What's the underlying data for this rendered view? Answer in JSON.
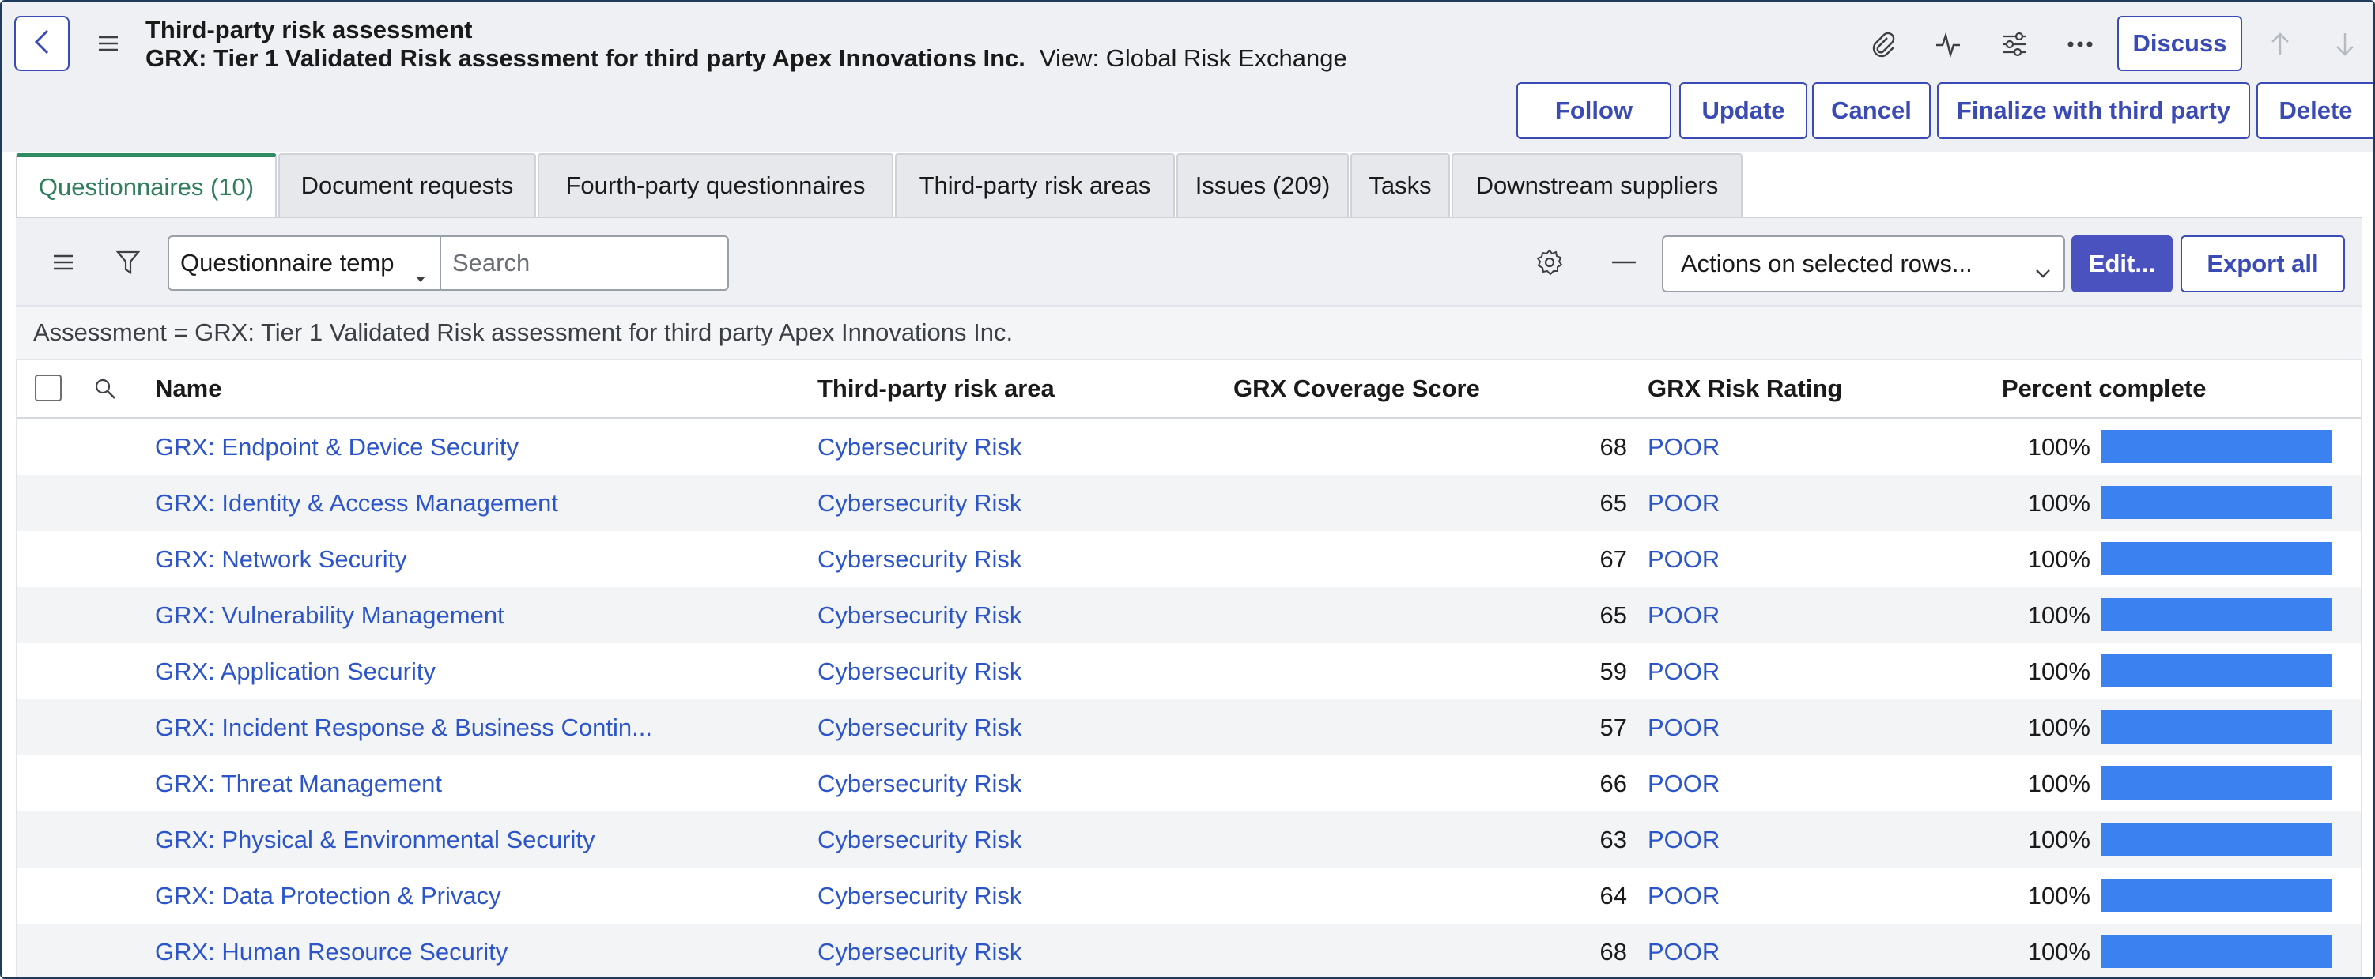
{
  "header": {
    "title": "Third-party risk assessment",
    "record_name": "GRX: Tier 1 Validated Risk assessment for third party Apex Innovations Inc.",
    "view_label": "View: Global Risk Exchange",
    "buttons": {
      "discuss": "Discuss",
      "follow": "Follow",
      "update": "Update",
      "cancel": "Cancel",
      "finalize": "Finalize with third party",
      "delete": "Delete"
    },
    "icons": [
      "back-icon",
      "hamburger-menu-icon",
      "paperclip-icon",
      "activity-icon",
      "settings-sliders-icon",
      "more-icon",
      "arrow-up-icon",
      "arrow-down-icon"
    ]
  },
  "tabs": [
    {
      "label": "Questionnaires (10)",
      "active": true
    },
    {
      "label": "Document requests",
      "active": false
    },
    {
      "label": "Fourth-party questionnaires",
      "active": false
    },
    {
      "label": "Third-party risk areas",
      "active": false
    },
    {
      "label": "Issues (209)",
      "active": false
    },
    {
      "label": "Tasks",
      "active": false
    },
    {
      "label": "Downstream suppliers",
      "active": false
    }
  ],
  "list": {
    "field_select": "Questionnaire temp",
    "search_placeholder": "Search",
    "actions_select": "Actions on selected rows...",
    "edit_label": "Edit...",
    "export_label": "Export all",
    "filter_text": "Assessment = GRX: Tier 1 Validated Risk assessment for third party Apex Innovations Inc.",
    "columns": {
      "name": "Name",
      "risk_area": "Third-party risk area",
      "coverage": "GRX Coverage Score",
      "rating": "GRX Risk Rating",
      "percent": "Percent complete"
    },
    "rows": [
      {
        "name": "GRX: Endpoint & Device Security",
        "risk_area": "Cybersecurity Risk",
        "coverage": "68",
        "rating": "POOR",
        "percent": "100%",
        "progress": 100
      },
      {
        "name": "GRX: Identity & Access Management",
        "risk_area": "Cybersecurity Risk",
        "coverage": "65",
        "rating": "POOR",
        "percent": "100%",
        "progress": 100
      },
      {
        "name": "GRX: Network Security",
        "risk_area": "Cybersecurity Risk",
        "coverage": "67",
        "rating": "POOR",
        "percent": "100%",
        "progress": 100
      },
      {
        "name": "GRX: Vulnerability Management",
        "risk_area": "Cybersecurity Risk",
        "coverage": "65",
        "rating": "POOR",
        "percent": "100%",
        "progress": 100
      },
      {
        "name": "GRX: Application Security",
        "risk_area": "Cybersecurity Risk",
        "coverage": "59",
        "rating": "POOR",
        "percent": "100%",
        "progress": 100
      },
      {
        "name": "GRX: Incident Response & Business Contin...",
        "risk_area": "Cybersecurity Risk",
        "coverage": "57",
        "rating": "POOR",
        "percent": "100%",
        "progress": 100
      },
      {
        "name": "GRX: Threat Management",
        "risk_area": "Cybersecurity Risk",
        "coverage": "66",
        "rating": "POOR",
        "percent": "100%",
        "progress": 100
      },
      {
        "name": "GRX: Physical & Environmental Security",
        "risk_area": "Cybersecurity Risk",
        "coverage": "63",
        "rating": "POOR",
        "percent": "100%",
        "progress": 100
      },
      {
        "name": "GRX: Data Protection & Privacy",
        "risk_area": "Cybersecurity Risk",
        "coverage": "64",
        "rating": "POOR",
        "percent": "100%",
        "progress": 100
      },
      {
        "name": "GRX: Human Resource Security",
        "risk_area": "Cybersecurity Risk",
        "coverage": "68",
        "rating": "POOR",
        "percent": "100%",
        "progress": 100
      }
    ]
  },
  "colors": {
    "accent": "#3b4bb5",
    "link": "#2c55c9",
    "active_tab": "#2e8b62",
    "progress": "#3b82f0",
    "primary_button": "#4a52c0"
  }
}
